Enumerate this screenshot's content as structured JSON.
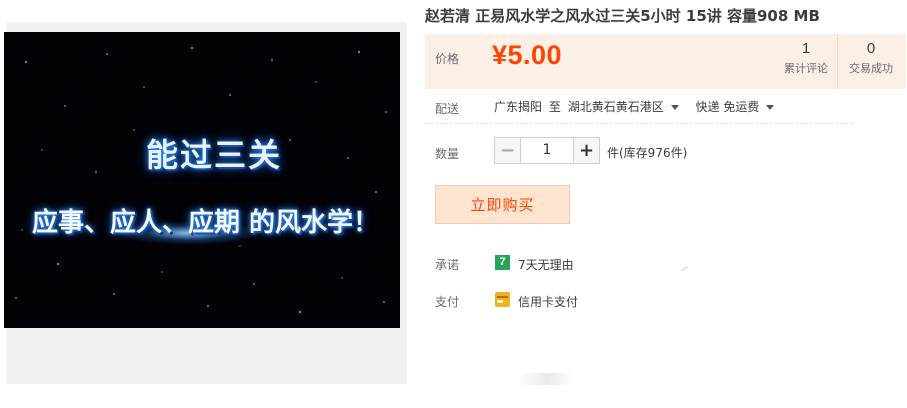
{
  "product": {
    "title": "赵若清 正易风水学之风水过三关5小时 15讲 容量908 MB",
    "image_text_line1": "能过三关",
    "image_text_line2": "应事、应人、应期 的风水学！"
  },
  "price": {
    "label": "价格",
    "value": "¥5.00",
    "accent_color": "#ff4400"
  },
  "stats": {
    "reviews_count": "1",
    "reviews_label": "累计评论",
    "deals_count": "0",
    "deals_label": "交易成功"
  },
  "shipping": {
    "label": "配送",
    "from": "广东揭阳",
    "to_word": "至",
    "destination": "湖北黄石黄石港区",
    "method": "快递 免运费"
  },
  "quantity": {
    "label": "数量",
    "minus": "−",
    "value": "1",
    "plus": "+",
    "stock": "件(库存976件)"
  },
  "buy": {
    "label": "立即购买"
  },
  "promise": {
    "label": "承诺",
    "badge": "7",
    "text": "7天无理由"
  },
  "payment": {
    "label": "支付",
    "icon": "credit-card-icon",
    "text": "信用卡支付"
  }
}
